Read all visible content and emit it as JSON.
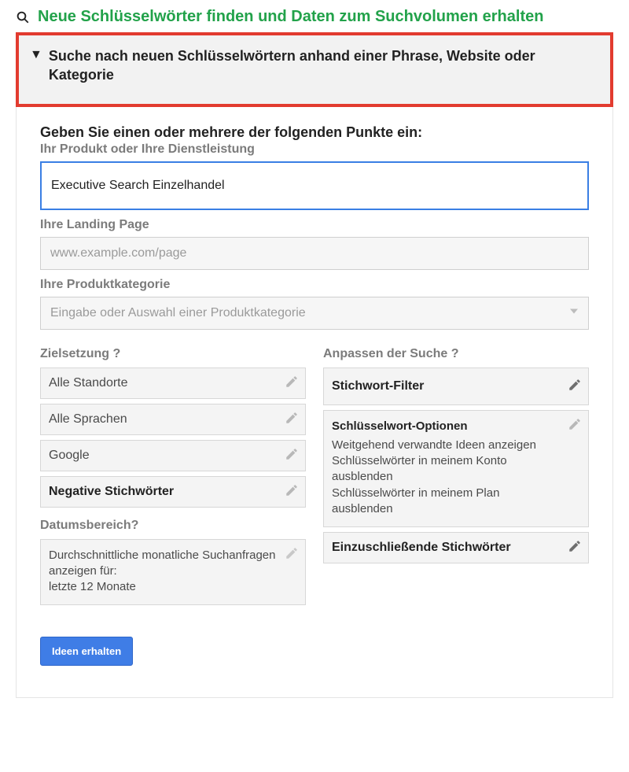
{
  "header": {
    "title": "Neue Schlüsselwörter finden und Daten zum Suchvolumen erhalten"
  },
  "accordion": {
    "title": "Suche nach neuen Schlüsselwörtern anhand einer Phrase, Website oder Kategorie"
  },
  "form": {
    "prompt": "Geben Sie einen oder mehrere der folgenden Punkte ein:",
    "product_label": "Ihr Produkt oder Ihre Dienstleistung",
    "product_value": "Executive Search Einzelhandel",
    "landing_label": "Ihre Landing Page",
    "landing_placeholder": "www.example.com/page",
    "category_label": "Ihre Produktkategorie",
    "category_placeholder": "Eingabe oder Auswahl einer Produktkategorie"
  },
  "targeting": {
    "title": "Zielsetzung ?",
    "location": "Alle Standorte",
    "language": "Alle Sprachen",
    "network": "Google",
    "negatives": "Negative Stichwörter"
  },
  "date": {
    "title": "Datumsbereich?",
    "line1": "Durchschnittliche monatliche Suchanfragen anzeigen für:",
    "line2": "letzte 12 Monate"
  },
  "customize": {
    "title": "Anpassen der Suche ?",
    "filter": "Stichwort-Filter",
    "options_title": "Schlüsselwort-Optionen",
    "options_l1": "Weitgehend verwandte Ideen anzeigen",
    "options_l2": "Schlüsselwörter in meinem Konto ausblenden",
    "options_l3": "Schlüsselwörter in meinem Plan ausblenden",
    "include": "Einzuschließende Stichwörter"
  },
  "submit": {
    "label": "Ideen erhalten"
  }
}
